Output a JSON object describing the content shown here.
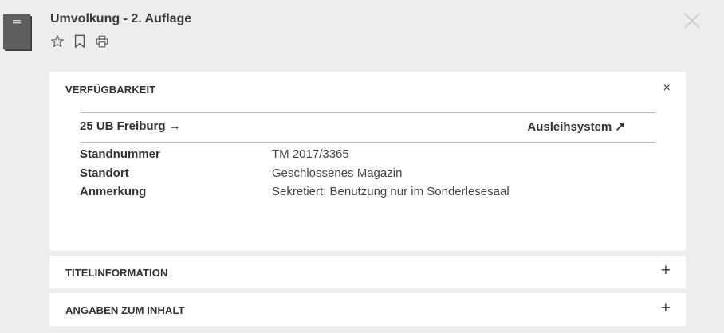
{
  "record": {
    "title": "Umvolkung - 2. Auflage"
  },
  "icons": {
    "book": "book-icon",
    "star": "star-icon",
    "bookmark": "bookmark-icon",
    "print": "print-icon",
    "close": "close-icon"
  },
  "availability": {
    "heading": "VERFÜGBARKEIT",
    "close_glyph": "×",
    "library": "25 UB Freiburg →",
    "system_link": "Ausleihsystem ↗",
    "rows": [
      {
        "label": "Standnummer",
        "value": "TM 2017/3365"
      },
      {
        "label": "Standort",
        "value": "Geschlossenes Magazin"
      },
      {
        "label": "Anmerkung",
        "value": "Sekretiert: Benutzung nur im Sonderlesesaal"
      }
    ]
  },
  "sections": [
    {
      "heading": "TITELINFORMATION",
      "toggle": "+"
    },
    {
      "heading": "ANGABEN ZUM INHALT",
      "toggle": "+"
    }
  ],
  "colors": {
    "background": "#ededed",
    "panel": "#ffffff",
    "text": "#333333"
  }
}
